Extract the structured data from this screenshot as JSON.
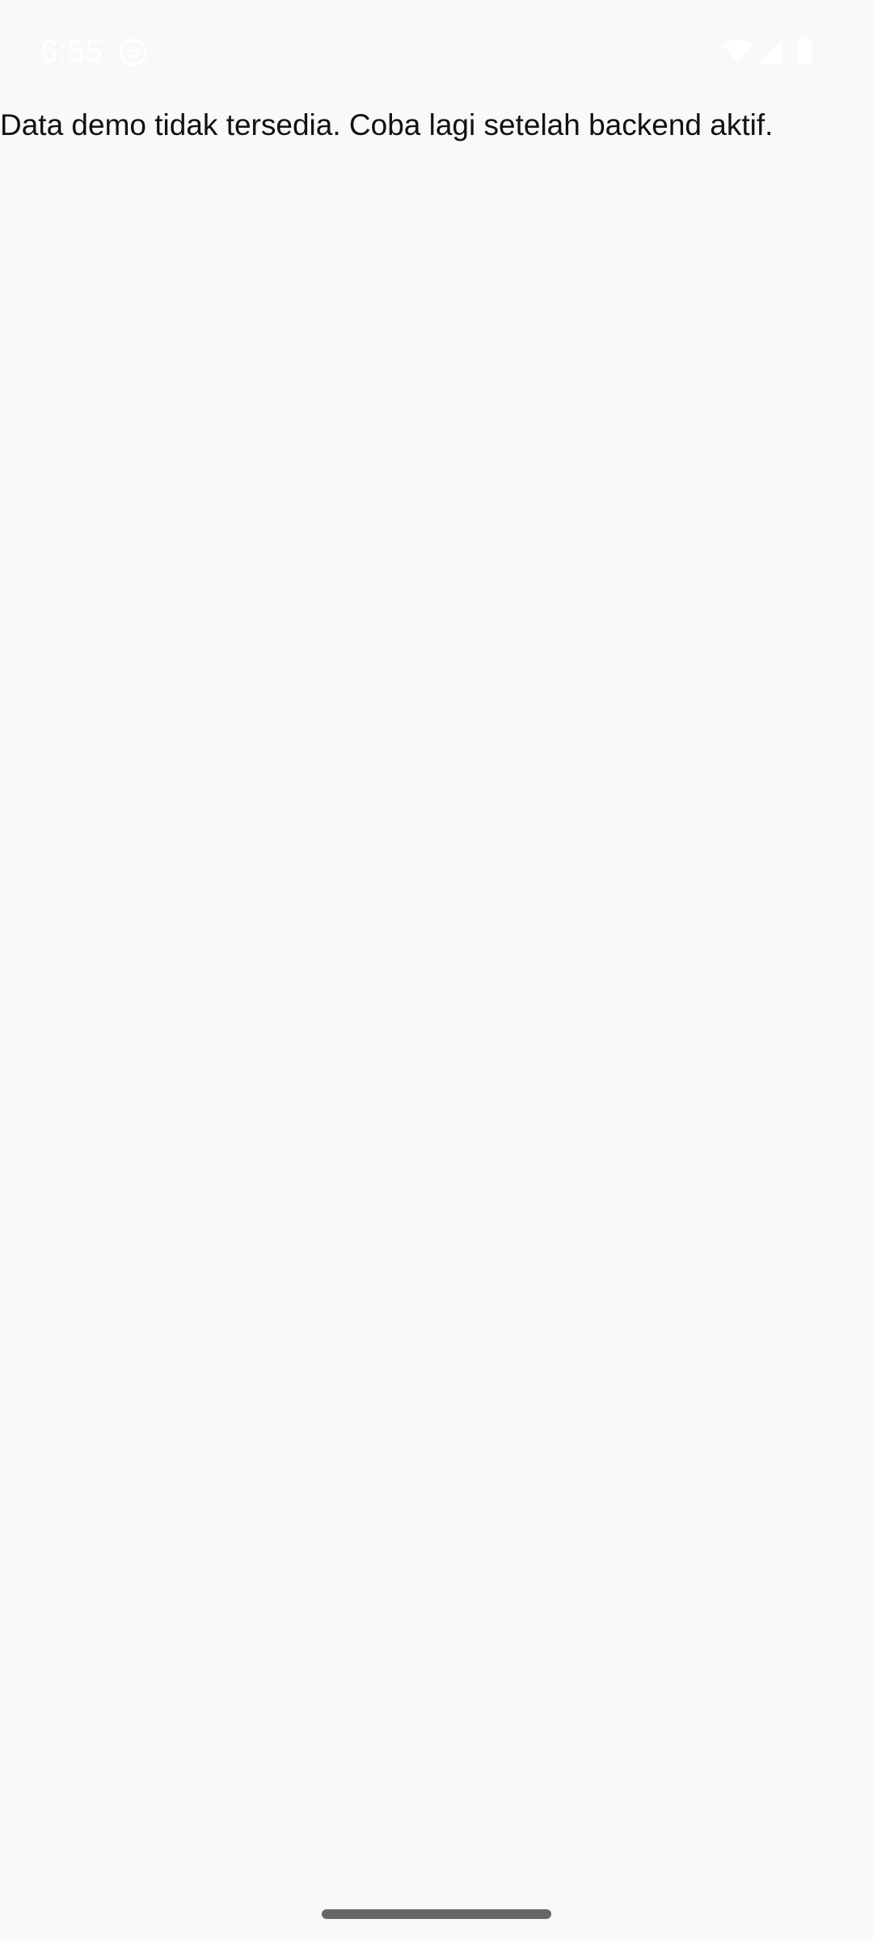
{
  "status_bar": {
    "time": "6:55",
    "icons": [
      "app-notification-icon",
      "wifi-icon",
      "cellular-signal-icon",
      "battery-icon"
    ]
  },
  "main": {
    "message": "Data demo tidak tersedia. Coba lagi setelah backend aktif."
  },
  "colors": {
    "background": "#f9f9f9",
    "text": "#111111",
    "status_icons": "#ffffff",
    "home_indicator": "#666666"
  }
}
